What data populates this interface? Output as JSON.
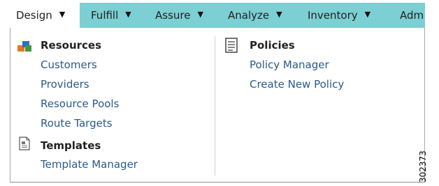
{
  "menubar": {
    "items": [
      {
        "label": "Design",
        "arrow": "▼"
      },
      {
        "label": "Fulfill",
        "arrow": "▼"
      },
      {
        "label": "Assure",
        "arrow": "▼"
      },
      {
        "label": "Analyze",
        "arrow": "▼"
      },
      {
        "label": "Inventory",
        "arrow": "▼"
      },
      {
        "label": "Adm"
      }
    ]
  },
  "dropdown": {
    "resources": {
      "title": "Resources",
      "icon": "resources-icon",
      "items": [
        "Customers",
        "Providers",
        "Resource Pools",
        "Route Targets"
      ]
    },
    "templates": {
      "title": "Templates",
      "icon": "template-icon",
      "items": [
        "Template Manager"
      ]
    },
    "policies": {
      "title": "Policies",
      "icon": "policy-icon",
      "items": [
        "Policy Manager",
        "Create New Policy"
      ]
    }
  },
  "figure_number": "302373",
  "colors": {
    "menubar_bg": "#7ccfd3",
    "link": "#2a5a8a",
    "active_tab_bg": "#ffffff"
  }
}
